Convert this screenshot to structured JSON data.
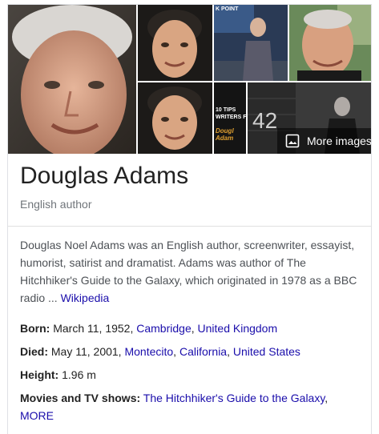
{
  "gallery": {
    "number_overlay": "42",
    "book_cover_text": [
      "10 TIPS",
      "WRITERS F",
      "Dougl",
      "Adam"
    ],
    "poster_text": "K POINT",
    "more_images_label": "More images"
  },
  "entity": {
    "title": "Douglas Adams",
    "subtitle": "English author"
  },
  "description": {
    "text": "Douglas Noel Adams was an English author, screenwriter, essayist, humorist, satirist and dramatist. Adams was author of The Hitchhiker's Guide to the Galaxy, which originated in 1978 as a BBC radio ... ",
    "source_link": "Wikipedia"
  },
  "facts": {
    "born": {
      "label": "Born:",
      "text": " March 11, 1952, ",
      "place1": "Cambridge",
      "sep": ", ",
      "place2": "United Kingdom"
    },
    "died": {
      "label": "Died:",
      "text": " May 11, 2001, ",
      "place1": "Montecito",
      "sep1": ", ",
      "place2": "California",
      "sep2": ", ",
      "place3": "United States"
    },
    "height": {
      "label": "Height:",
      "text": " 1.96 m"
    },
    "movies": {
      "label": "Movies and TV shows:",
      "sep": " ",
      "link1": "The Hitchhiker's Guide to the Galaxy",
      "comma": ",",
      "more": "MORE"
    }
  },
  "colors": {
    "link": "#1a0dab",
    "subtitle": "#70757a",
    "text": "#4d5156"
  }
}
